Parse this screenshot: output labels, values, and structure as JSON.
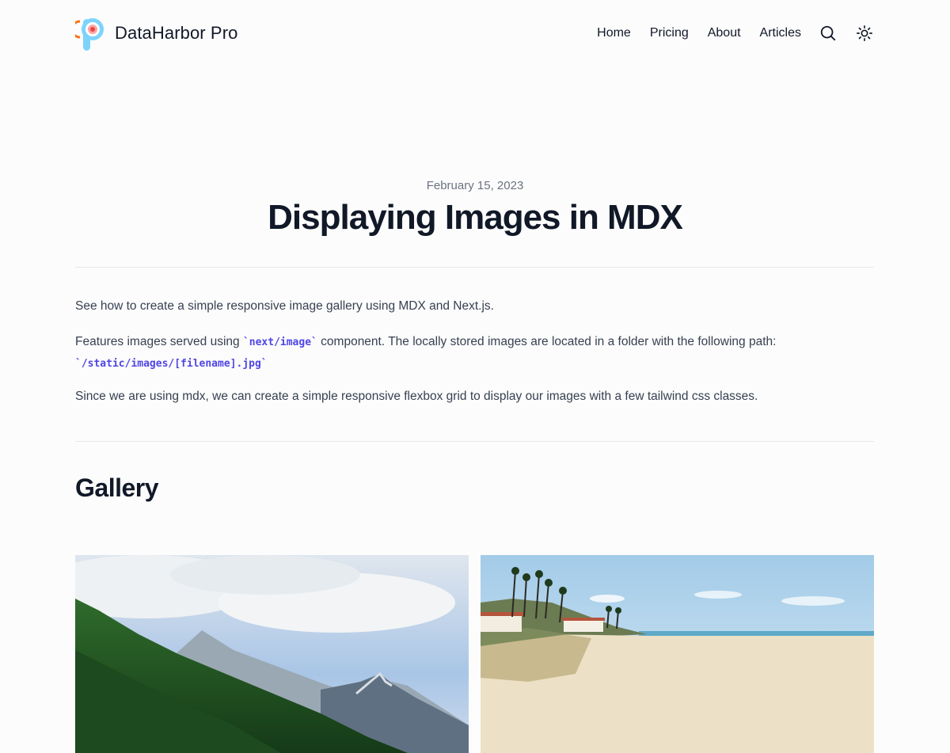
{
  "header": {
    "brand": "DataHarbor Pro",
    "nav": [
      {
        "label": "Home"
      },
      {
        "label": "Pricing"
      },
      {
        "label": "About"
      },
      {
        "label": "Articles"
      }
    ],
    "icons": [
      "search-icon",
      "theme-toggle-icon"
    ]
  },
  "article": {
    "date": "February 15, 2023",
    "title": "Displaying Images in MDX",
    "intro": "See how to create a simple responsive image gallery using MDX and Next.js.",
    "features_prefix": "Features images served using ",
    "features_code": "`next/image`",
    "features_suffix": " component. The locally stored images are located in a folder with the following path:",
    "path_code": "`/static/images/[filename].jpg`",
    "mdx_note": "Since we are using mdx, we can create a simple responsive flexbox grid to display our images with a few tailwind css classes.",
    "gallery_heading": "Gallery"
  },
  "colors": {
    "code": "#4f46e5",
    "text": "#374151",
    "heading": "#111827"
  }
}
